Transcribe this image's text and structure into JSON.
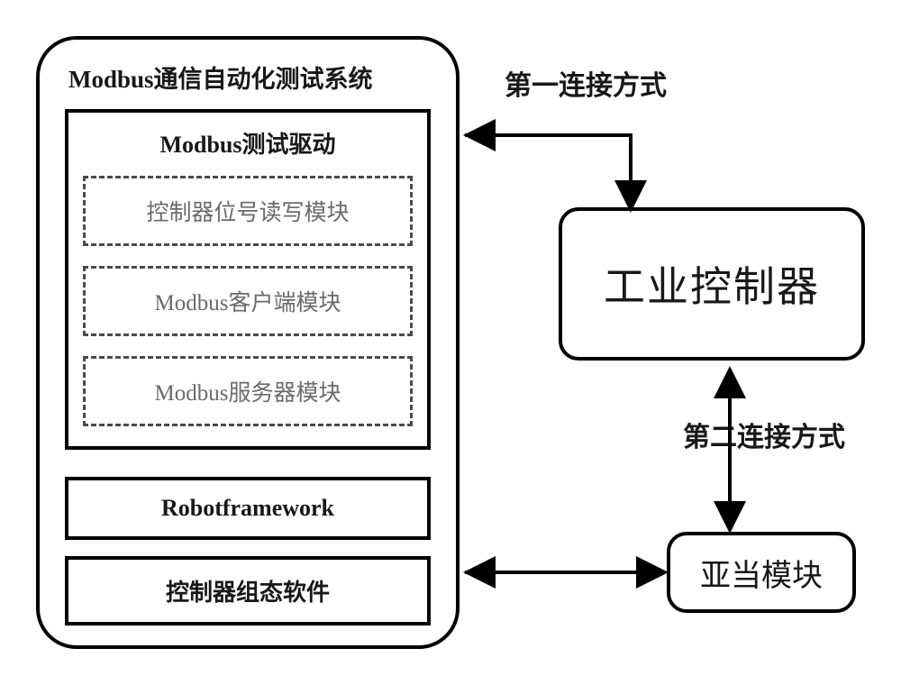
{
  "system": {
    "title": "Modbus通信自动化测试系统",
    "driver": {
      "title": "Modbus测试驱动",
      "modules": [
        "控制器位号读写模块",
        "Modbus客户端模块",
        "Modbus服务器模块"
      ]
    },
    "bottom_modules": [
      "Robotframework",
      "控制器组态软件"
    ]
  },
  "controller": "工业控制器",
  "adam": "亚当模块",
  "connection_labels": {
    "first": "第一连接方式",
    "second": "第二连接方式"
  }
}
